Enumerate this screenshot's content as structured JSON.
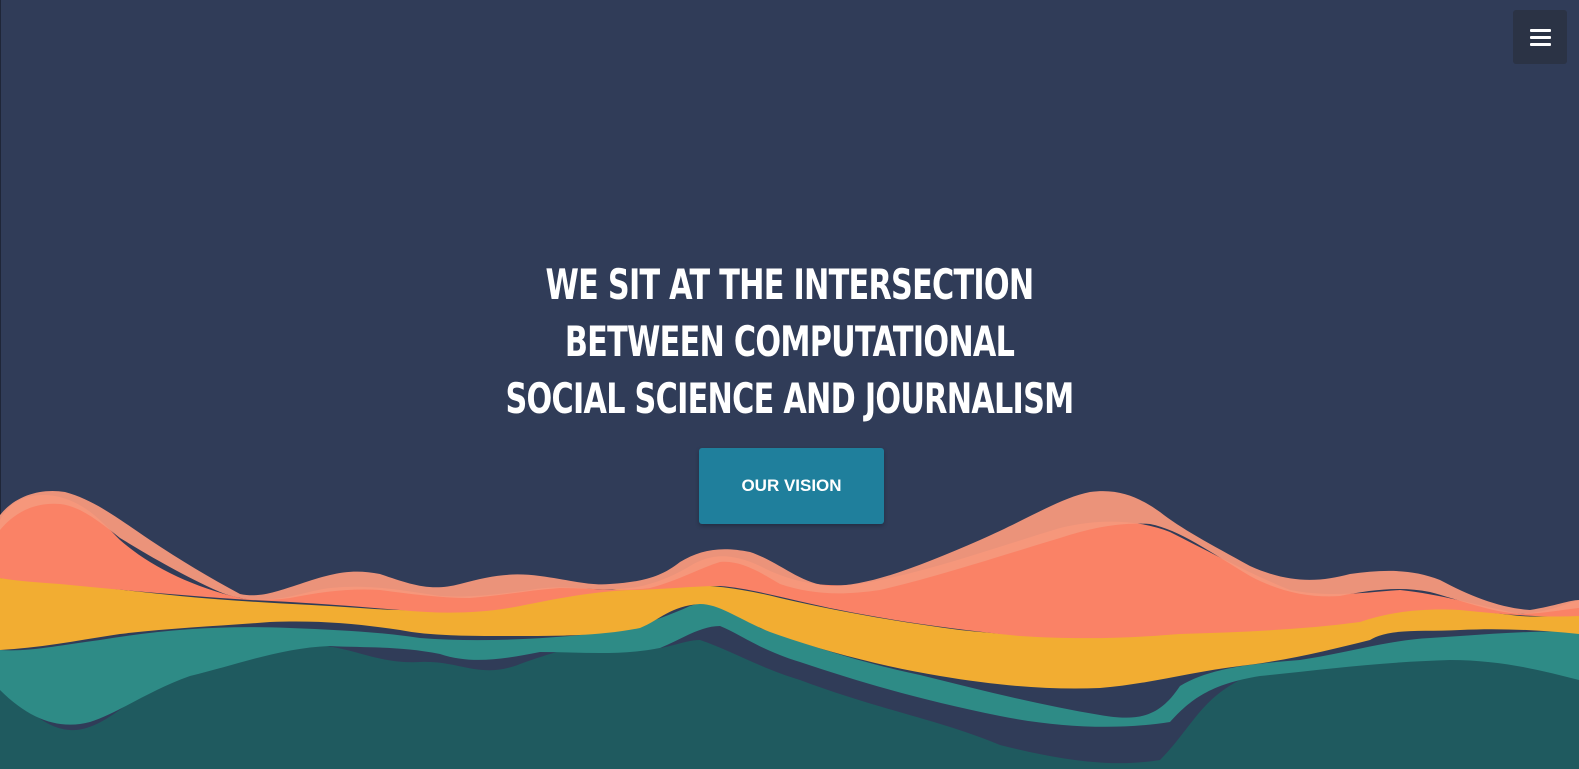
{
  "header": {
    "menu_icon": "hamburger-menu-icon"
  },
  "hero": {
    "headline_lines": [
      "WE SIT AT THE INTERSECTION",
      "BETWEEN COMPUTATIONAL",
      "SOCIAL SCIENCE AND JOURNALISM"
    ],
    "cta_label": "OUR VISION"
  },
  "colors": {
    "background": "#303c58",
    "cta_background": "#1f7f9c",
    "menu_background": "#2b3345",
    "wave_salmon_light": "#f6987c",
    "wave_salmon": "#fa8266",
    "wave_yellow": "#f2ad32",
    "wave_teal": "#2e8b86",
    "wave_teal_dark": "#1f5a5f"
  }
}
